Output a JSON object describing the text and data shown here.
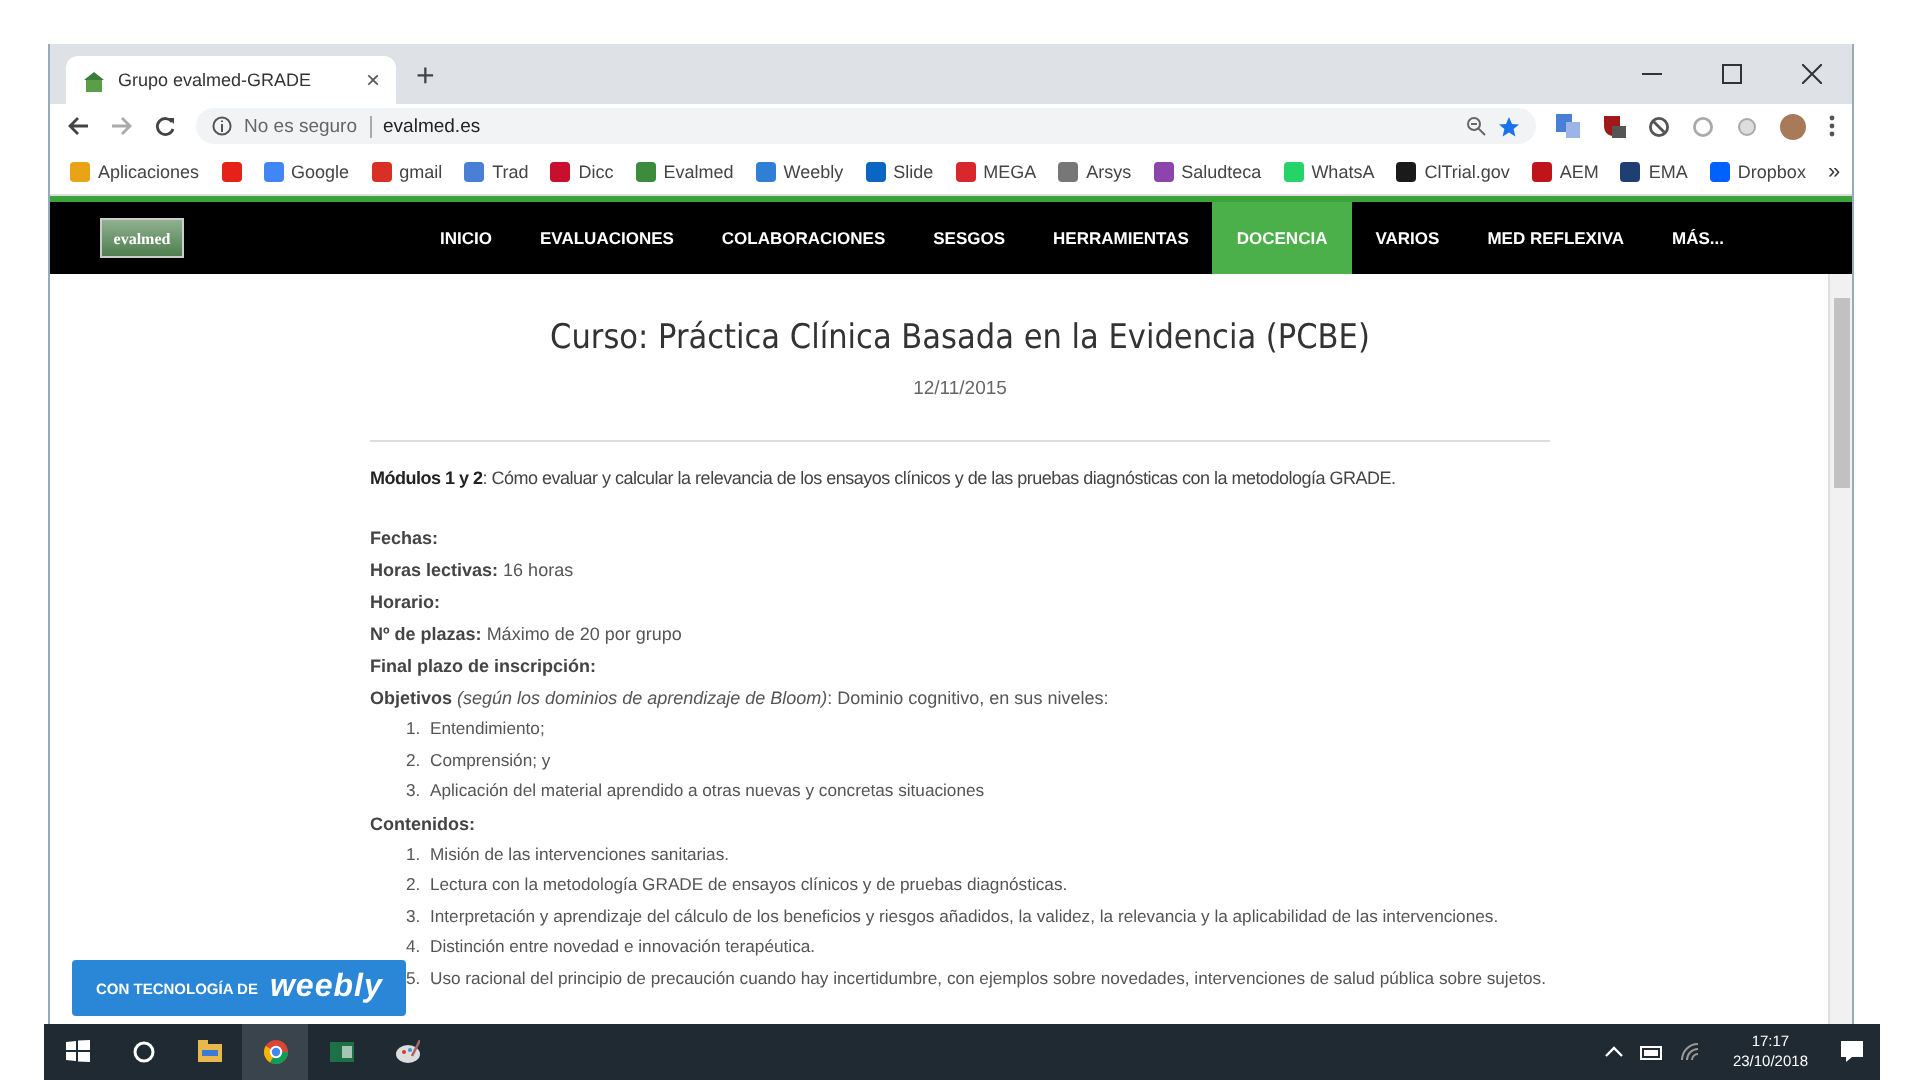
{
  "browser": {
    "tab": {
      "title": "Grupo evalmed-GRADE",
      "close": "×",
      "selected": true
    },
    "new_tab": "+",
    "address": {
      "security": "No es seguro",
      "url": "evalmed.es"
    },
    "bookmarks": [
      {
        "label": "Aplicaciones",
        "color": "#e8a317"
      },
      {
        "color": "#e62117"
      },
      {
        "label": "Google",
        "color": "#4285f4"
      },
      {
        "label": "gmail",
        "color": "#d93025"
      },
      {
        "label": "Trad",
        "color": "#4a7fd6"
      },
      {
        "label": "Dicc",
        "color": "#c8102e"
      },
      {
        "label": "Evalmed",
        "color": "#3d8b3d"
      },
      {
        "label": "Weebly",
        "color": "#2f7fd6"
      },
      {
        "label": "Slide",
        "color": "#0a66c2"
      },
      {
        "label": "MEGA",
        "color": "#d9272e"
      },
      {
        "label": "Arsys",
        "color": "#777777"
      },
      {
        "label": "Saludteca",
        "color": "#8e44ad"
      },
      {
        "label": "WhatsA",
        "color": "#25d366"
      },
      {
        "label": "ClTrial.gov",
        "color": "#1a1a1a"
      },
      {
        "label": "AEM",
        "color": "#c0141b"
      },
      {
        "label": "EMA",
        "color": "#1d3f72"
      },
      {
        "label": "Dropbox",
        "color": "#0061ff"
      }
    ],
    "bookmarks_more": "»"
  },
  "site": {
    "logo": "evalmed",
    "nav": [
      {
        "label": "INICIO",
        "selected": false
      },
      {
        "label": "EVALUACIONES",
        "selected": false
      },
      {
        "label": "COLABORACIONES",
        "selected": false
      },
      {
        "label": "SESGOS",
        "selected": false
      },
      {
        "label": "HERRAMIENTAS",
        "selected": false
      },
      {
        "label": "DOCENCIA",
        "selected": true
      },
      {
        "label": "VARIOS",
        "selected": false
      },
      {
        "label": "MED REFLEXIVA",
        "selected": false
      },
      {
        "label": "MÁS...",
        "selected": false
      }
    ]
  },
  "article": {
    "title": "Curso: Práctica Clínica Basada en la Evidencia (PCBE)",
    "date": "12/11/2015",
    "intro": "**Módulos 1 y 2**: Cómo evaluar y calcular la relevancia de los ensayos clínicos y de las pruebas diagnósticas con la metodología GRADE.",
    "fields": [
      "**Fechas:**",
      "**Horas lectivas:**  16 horas",
      "**Horario:**",
      "**Nº de plazas:** Máximo de 20 por grupo",
      "**Final plazo de inscripción:**",
      "**Objetivos** *(según los dominios de aprendizaje de Bloom)*: Dominio cognitivo, en sus niveles:"
    ],
    "objectives": [
      {
        "num": "1.",
        "text": "Entendimiento;"
      },
      {
        "num": "2.",
        "text": "Comprensión; y"
      },
      {
        "num": "3.",
        "text": "Aplicación del material aprendido a otras nuevas y concretas situaciones"
      }
    ],
    "contents_heading": "Contenidos:",
    "contents": [
      {
        "num": "1.",
        "text": "Misión de las intervenciones sanitarias."
      },
      {
        "num": "2.",
        "text": "Lectura con la metodología GRADE de ensayos clínicos y de pruebas diagnósticas."
      },
      {
        "num": "3.",
        "text": "Interpretación y aprendizaje del cálculo de los beneficios y riesgos añadidos, la validez, la relevancia y la aplicabilidad de las intervenciones."
      },
      {
        "num": "4.",
        "text": "Distinción entre novedad e innovación terapéutica."
      },
      {
        "num": "5.",
        "text": "Uso racional del principio de precaución cuando hay incertidumbre, con ejemplos sobre novedades, intervenciones de salud pública sobre sujetos."
      }
    ]
  },
  "badge": {
    "prefix": "CON TECNOLOGÍA DE",
    "brand": "weebly"
  },
  "taskbar": {
    "time": "17:17",
    "date": "23/10/2018"
  }
}
